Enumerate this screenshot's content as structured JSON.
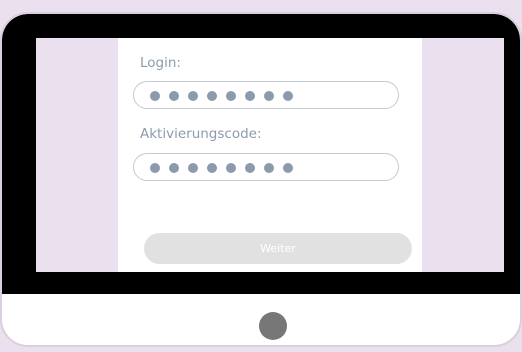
{
  "form": {
    "login_label": "Login:",
    "login_dot_count": 8,
    "activation_label": "Aktivierungscode:",
    "activation_dot_count": 8,
    "submit_label": "Weiter"
  },
  "colors": {
    "background": "#ebe0ee",
    "bezel": "#000000",
    "label_text": "#8d9cab",
    "dot": "#8b9bab",
    "button_bg": "#e1e1e1",
    "home_button": "#777777"
  },
  "icons": {
    "home_button": "home-button-icon"
  }
}
